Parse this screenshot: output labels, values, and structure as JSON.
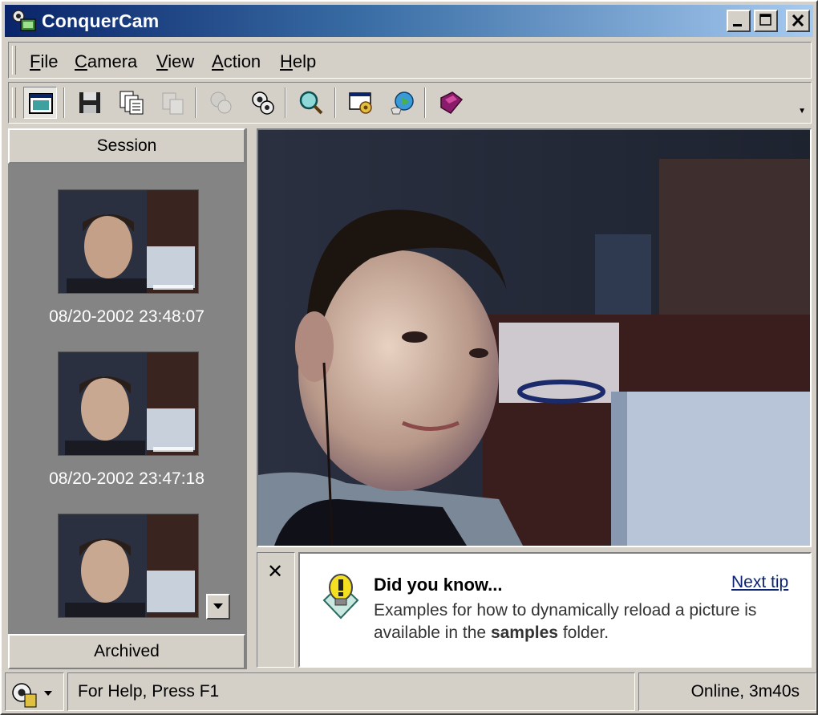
{
  "window": {
    "title": "ConquerCam"
  },
  "menu": {
    "items": [
      {
        "label": "File",
        "accel": "F",
        "rest": "ile"
      },
      {
        "label": "Camera",
        "accel": "C",
        "rest": "amera"
      },
      {
        "label": "View",
        "accel": "V",
        "rest": "iew"
      },
      {
        "label": "Action",
        "accel": "A",
        "rest": "ction"
      },
      {
        "label": "Help",
        "accel": "H",
        "rest": "elp"
      }
    ]
  },
  "toolbar": {
    "buttons": [
      {
        "icon": "preview-window-icon",
        "pressed": true
      },
      {
        "icon": "save-disk-icon"
      },
      {
        "icon": "copy-icon"
      },
      {
        "icon": "paste-icon",
        "disabled": true
      },
      {
        "icon": "connect-icon",
        "disabled": true
      },
      {
        "icon": "disconnect-icon"
      },
      {
        "icon": "zoom-search-icon"
      },
      {
        "icon": "settings-window-icon"
      },
      {
        "icon": "globe-publish-icon"
      },
      {
        "icon": "help-book-icon"
      }
    ]
  },
  "session": {
    "header": "Session",
    "thumbnails": [
      {
        "timestamp": "08/20-2002 23:48:07"
      },
      {
        "timestamp": "08/20-2002 23:47:18"
      },
      {
        "timestamp": ""
      }
    ],
    "footer": "Archived"
  },
  "tip": {
    "title": "Did you know...",
    "next": "Next tip",
    "text_before": "Examples for how to dynamically reload a picture is available in the ",
    "text_bold": "samples",
    "text_after": " folder."
  },
  "status": {
    "help": "For Help, Press F1",
    "connection": "Online, 3m40s"
  },
  "colors": {
    "titlebar_start": "#0a246a",
    "titlebar_end": "#a6caf0",
    "face": "#d4d0c8",
    "link": "#0a2473"
  }
}
